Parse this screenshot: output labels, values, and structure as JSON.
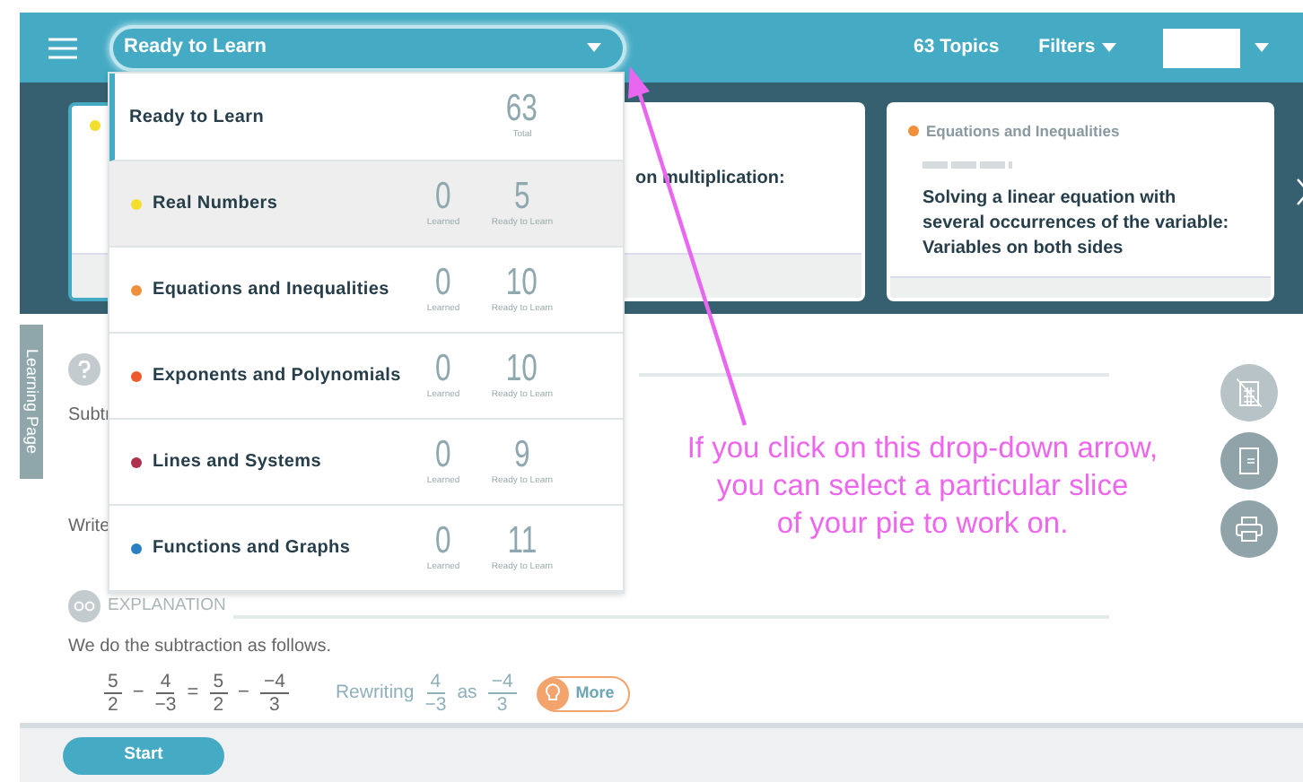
{
  "header": {
    "selector_label": "Ready to Learn",
    "topics": "63 Topics",
    "filters": "Filters"
  },
  "dropdown": {
    "header": {
      "label": "Ready to Learn",
      "total": "63",
      "total_label": "Total",
      "selected": true
    },
    "items": [
      {
        "name": "Real Numbers",
        "color": "#f3de2c",
        "learned": "0",
        "learned_label": "Learned",
        "ready": "5",
        "ready_label": "Ready to Learn",
        "selected": true
      },
      {
        "name": "Equations and Inequalities",
        "color": "#f0903a",
        "learned": "0",
        "learned_label": "Learned",
        "ready": "10",
        "ready_label": "Ready to Learn",
        "selected": false
      },
      {
        "name": "Exponents and Polynomials",
        "color": "#ee5a2c",
        "learned": "0",
        "learned_label": "Learned",
        "ready": "10",
        "ready_label": "Ready to Learn",
        "selected": false
      },
      {
        "name": "Lines and Systems",
        "color": "#b0314f",
        "learned": "0",
        "learned_label": "Learned",
        "ready": "9",
        "ready_label": "Ready to Learn",
        "selected": false
      },
      {
        "name": "Functions and Graphs",
        "color": "#2d7fc4",
        "learned": "0",
        "learned_label": "Learned",
        "ready": "11",
        "ready_label": "Ready to Learn",
        "selected": false
      }
    ]
  },
  "cards": [
    {
      "color": "#f3de2c",
      "selected": true
    },
    {
      "title": "on multiplication:",
      "selected": false
    },
    {
      "color": "#f0903a",
      "category": "Equations and Inequalities",
      "title": "Solving a linear equation with several occurrences of the variable: Variables on both sides",
      "selected": false
    }
  ],
  "side_tab": "Learning Page",
  "question": {
    "line_1": "Subtr",
    "line_2": "Write"
  },
  "explanation": {
    "heading": "EXPLANATION",
    "intro": "We do the subtraction as follows.",
    "equation": [
      {
        "kind": "frac",
        "num": "5",
        "den": "2"
      },
      {
        "kind": "op",
        "text": "−"
      },
      {
        "kind": "frac",
        "num": "4",
        "den": "−3"
      },
      {
        "kind": "op",
        "text": "="
      },
      {
        "kind": "frac",
        "num": "5",
        "den": "2"
      },
      {
        "kind": "op",
        "text": "−"
      },
      {
        "kind": "frac",
        "num": "−4",
        "den": "3"
      }
    ],
    "hint": [
      {
        "kind": "word",
        "text": "Rewriting"
      },
      {
        "kind": "frac",
        "num": "4",
        "den": "−3"
      },
      {
        "kind": "word",
        "text": "as"
      },
      {
        "kind": "frac",
        "num": "−4",
        "den": "3"
      }
    ],
    "more_button": "More"
  },
  "start_button": "Start",
  "annotation": [
    "If you click on this drop-down arrow,",
    "you can select a particular slice",
    "of your pie to work on."
  ]
}
